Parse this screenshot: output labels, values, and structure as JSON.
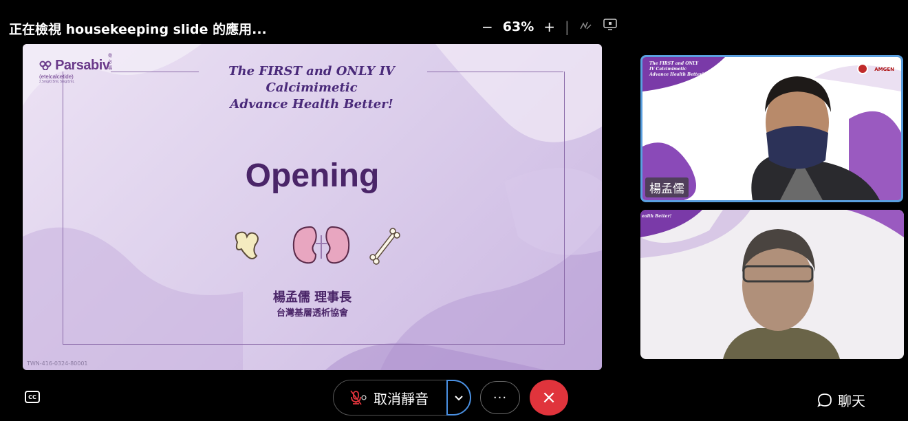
{
  "header": {
    "viewing_text": "正在檢視 housekeeping slide 的應用...",
    "zoom_minus": "−",
    "zoom_level": "63%",
    "zoom_plus": "+",
    "separator": "|"
  },
  "slide": {
    "logo_brand": "Parsabiv",
    "logo_generic": "(etelcalcetide)",
    "logo_cn": "骨必福",
    "logo_doses": "2.5mg/0.5mL   5mg/1mL",
    "tagline_line1": "The FIRST and ONLY IV Calcimimetic",
    "tagline_line2": "Advance Health Better!",
    "title": "Opening",
    "speaker": "楊孟儒 理事長",
    "association": "台灣基層透析協會",
    "code": "TWN-416-0324-80001"
  },
  "participants": [
    {
      "name": "楊孟儒",
      "background_text": [
        "The FIRST and ONLY",
        "IV Calcimimetic",
        "Advance Health Better!"
      ],
      "sponsor": "AMGEN",
      "active_speaker": true
    },
    {
      "name": "",
      "background_text": "ealth Better!",
      "active_speaker": false
    }
  ],
  "controls": {
    "cc_label": "CC",
    "mute_label": "取消靜音",
    "more_label": "···",
    "end_label": "×",
    "chat_label": "聊天"
  },
  "colors": {
    "accent_blue": "#4a90e2",
    "end_call_red": "#e0343c",
    "slide_purple": "#4a2568"
  }
}
